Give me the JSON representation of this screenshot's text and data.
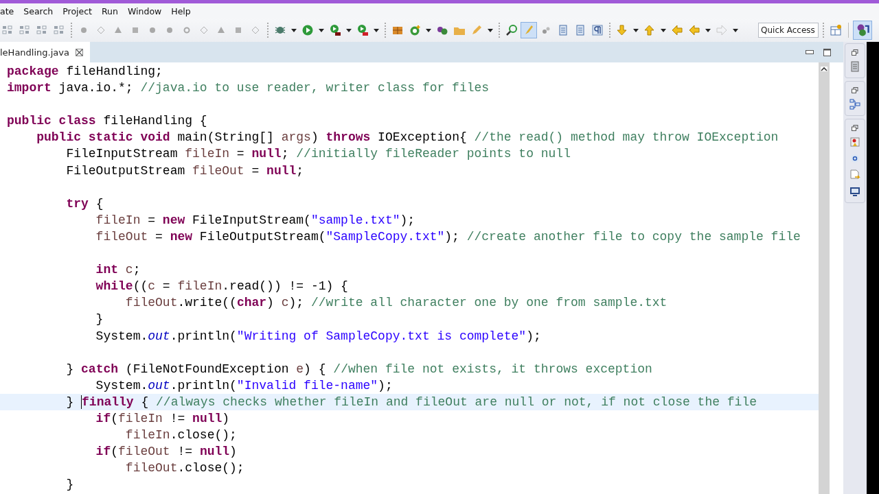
{
  "menu_bar": {
    "items": [
      "ate",
      "Search",
      "Project",
      "Run",
      "Window",
      "Help"
    ]
  },
  "toolbar": {
    "quick_access": {
      "placeholder": "Quick Access"
    }
  },
  "editor_tabs": [
    {
      "label": "leHandling.java",
      "selected": true
    }
  ],
  "code": {
    "lines": [
      {
        "current": false,
        "segments": [
          {
            "kind": "kw",
            "text": "package"
          },
          {
            "kind": "plain",
            "text": " fileHandling;"
          }
        ]
      },
      {
        "current": false,
        "segments": [
          {
            "kind": "kw",
            "text": "import"
          },
          {
            "kind": "plain",
            "text": " java.io.*; "
          },
          {
            "kind": "comment",
            "text": "//java.io to use reader, writer class for files"
          }
        ]
      },
      {
        "current": false
      },
      {
        "current": false,
        "segments": [
          {
            "kind": "kw",
            "text": "public class"
          },
          {
            "kind": "plain",
            "text": " fileHandling {"
          }
        ]
      },
      {
        "current": false,
        "segments": [
          {
            "kind": "kw",
            "text": "    public static void"
          },
          {
            "kind": "plain",
            "text": " main(String[] "
          },
          {
            "kind": "var",
            "text": "args"
          },
          {
            "kind": "plain",
            "text": ") "
          },
          {
            "kind": "kw",
            "text": "throws"
          },
          {
            "kind": "plain",
            "text": " IOException{ "
          },
          {
            "kind": "comment",
            "text": "//the read() method may throw IOException"
          }
        ]
      },
      {
        "current": false,
        "segments": [
          {
            "kind": "plain",
            "text": "        FileInputStream "
          },
          {
            "kind": "var",
            "text": "fileIn"
          },
          {
            "kind": "plain",
            "text": " = "
          },
          {
            "kind": "kw",
            "text": "null"
          },
          {
            "kind": "plain",
            "text": "; "
          },
          {
            "kind": "comment",
            "text": "//initially fileReader points to null"
          }
        ]
      },
      {
        "current": false,
        "segments": [
          {
            "kind": "plain",
            "text": "        FileOutputStream "
          },
          {
            "kind": "var",
            "text": "fileOut"
          },
          {
            "kind": "plain",
            "text": " = "
          },
          {
            "kind": "kw",
            "text": "null"
          },
          {
            "kind": "plain",
            "text": ";"
          }
        ]
      },
      {
        "current": false
      },
      {
        "current": false,
        "segments": [
          {
            "kind": "kw",
            "text": "        try"
          },
          {
            "kind": "plain",
            "text": " {"
          }
        ]
      },
      {
        "current": false,
        "segments": [
          {
            "kind": "var",
            "text": "            fileIn"
          },
          {
            "kind": "plain",
            "text": " = "
          },
          {
            "kind": "kw",
            "text": "new"
          },
          {
            "kind": "plain",
            "text": " FileInputStream("
          },
          {
            "kind": "str",
            "text": "\"sample.txt\""
          },
          {
            "kind": "plain",
            "text": ");"
          }
        ]
      },
      {
        "current": false,
        "segments": [
          {
            "kind": "var",
            "text": "            fileOut"
          },
          {
            "kind": "plain",
            "text": " = "
          },
          {
            "kind": "kw",
            "text": "new"
          },
          {
            "kind": "plain",
            "text": " FileOutputStream("
          },
          {
            "kind": "str",
            "text": "\"SampleCopy.txt\""
          },
          {
            "kind": "plain",
            "text": "); "
          },
          {
            "kind": "comment",
            "text": "//create another file to copy the sample file"
          }
        ]
      },
      {
        "current": false
      },
      {
        "current": false,
        "segments": [
          {
            "kind": "kw",
            "text": "            int "
          },
          {
            "kind": "var",
            "text": "c"
          },
          {
            "kind": "plain",
            "text": ";"
          }
        ]
      },
      {
        "current": false,
        "segments": [
          {
            "kind": "kw",
            "text": "            while"
          },
          {
            "kind": "plain",
            "text": "(("
          },
          {
            "kind": "var",
            "text": "c"
          },
          {
            "kind": "plain",
            "text": " = "
          },
          {
            "kind": "var",
            "text": "fileIn"
          },
          {
            "kind": "plain",
            "text": ".read()) != -1) {"
          }
        ]
      },
      {
        "current": false,
        "segments": [
          {
            "kind": "var",
            "text": "                fileOut"
          },
          {
            "kind": "plain",
            "text": ".write(("
          },
          {
            "kind": "kw",
            "text": "char"
          },
          {
            "kind": "plain",
            "text": ") "
          },
          {
            "kind": "var",
            "text": "c"
          },
          {
            "kind": "plain",
            "text": "); "
          },
          {
            "kind": "comment",
            "text": "//write all character one by one from sample.txt"
          }
        ]
      },
      {
        "current": false,
        "segments": [
          {
            "kind": "plain",
            "text": "            }"
          }
        ]
      },
      {
        "current": false,
        "segments": [
          {
            "kind": "plain",
            "text": "            System."
          },
          {
            "kind": "field",
            "text": "out"
          },
          {
            "kind": "plain",
            "text": ".println("
          },
          {
            "kind": "str",
            "text": "\"Writing of SampleCopy.txt is complete\""
          },
          {
            "kind": "plain",
            "text": ");"
          }
        ]
      },
      {
        "current": false
      },
      {
        "current": false,
        "segments": [
          {
            "kind": "plain",
            "text": "        } "
          },
          {
            "kind": "kw",
            "text": "catch"
          },
          {
            "kind": "plain",
            "text": " (FileNotFoundException "
          },
          {
            "kind": "var",
            "text": "e"
          },
          {
            "kind": "plain",
            "text": ") { "
          },
          {
            "kind": "comment",
            "text": "//when file not exists, it throws exception"
          }
        ]
      },
      {
        "current": false,
        "segments": [
          {
            "kind": "plain",
            "text": "            System."
          },
          {
            "kind": "field",
            "text": "out"
          },
          {
            "kind": "plain",
            "text": ".println("
          },
          {
            "kind": "str",
            "text": "\"Invalid file-name\""
          },
          {
            "kind": "plain",
            "text": ");"
          }
        ]
      },
      {
        "current": true,
        "segments": [
          {
            "kind": "plain",
            "text": "        } "
          },
          {
            "kind": "kw",
            "text": "finally",
            "caret": true
          },
          {
            "kind": "plain",
            "text": " { "
          },
          {
            "kind": "comment",
            "text": "//always checks whether fileIn and fileOut are null or not, if not close the file"
          }
        ]
      },
      {
        "current": false,
        "segments": [
          {
            "kind": "kw",
            "text": "            if"
          },
          {
            "kind": "plain",
            "text": "("
          },
          {
            "kind": "var",
            "text": "fileIn"
          },
          {
            "kind": "plain",
            "text": " != "
          },
          {
            "kind": "kw",
            "text": "null"
          },
          {
            "kind": "plain",
            "text": ")"
          }
        ]
      },
      {
        "current": false,
        "segments": [
          {
            "kind": "var",
            "text": "                fileIn"
          },
          {
            "kind": "plain",
            "text": ".close();"
          }
        ]
      },
      {
        "current": false,
        "segments": [
          {
            "kind": "kw",
            "text": "            if"
          },
          {
            "kind": "plain",
            "text": "("
          },
          {
            "kind": "var",
            "text": "fileOut"
          },
          {
            "kind": "plain",
            "text": " != "
          },
          {
            "kind": "kw",
            "text": "null"
          },
          {
            "kind": "plain",
            "text": ")"
          }
        ]
      },
      {
        "current": false,
        "segments": [
          {
            "kind": "var",
            "text": "                fileOut"
          },
          {
            "kind": "plain",
            "text": ".close();"
          }
        ]
      },
      {
        "current": false,
        "segments": [
          {
            "kind": "plain",
            "text": "        }"
          }
        ]
      }
    ]
  }
}
